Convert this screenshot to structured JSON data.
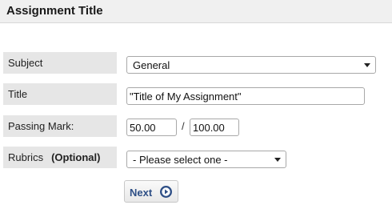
{
  "header": {
    "title": "Assignment Title"
  },
  "form": {
    "subject": {
      "label": "Subject",
      "value": "General"
    },
    "title": {
      "label": "Title",
      "value": "\"Title of My Assignment\""
    },
    "passing_mark": {
      "label": "Passing Mark:",
      "value": "50.00",
      "separator": "/",
      "total": "100.00"
    },
    "rubrics": {
      "label": "Rubrics",
      "optional": "(Optional)",
      "value": "- Please select one -"
    }
  },
  "actions": {
    "next_label": "Next",
    "next_icon": "arrow-right-circle-icon"
  },
  "colors": {
    "accent": "#2e4f86",
    "label_bg": "#e6e6e6",
    "header_bg": "#f0f0f0"
  }
}
